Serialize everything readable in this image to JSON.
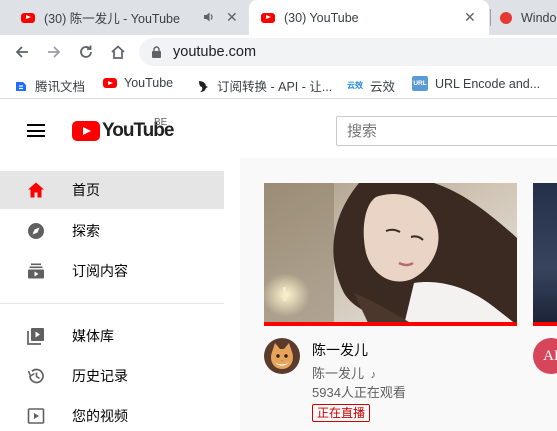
{
  "browser": {
    "tabs": [
      {
        "title": "(30) 陈一发儿 - YouTube",
        "active": false,
        "audio": true
      },
      {
        "title": "(30) YouTube",
        "active": true
      },
      {
        "title": "Windo",
        "active": false
      }
    ],
    "url": "youtube.com",
    "bookmarks": [
      {
        "label": "腾讯文档",
        "icon": "tencent-docs-icon"
      },
      {
        "label": "YouTube",
        "icon": "youtube-icon"
      },
      {
        "label": "订阅转换 - API - 让...",
        "icon": "bird-icon"
      },
      {
        "label": "云效",
        "icon": "yunxiao-icon",
        "icon_text": "云效"
      },
      {
        "label": "URL Encode and...",
        "icon": "url-icon",
        "icon_text": "URL"
      }
    ]
  },
  "masthead": {
    "logo_text": "YouTube",
    "country_code": "BE",
    "search_placeholder": "搜索"
  },
  "sidebar": {
    "items": [
      {
        "label": "首页",
        "icon": "home-icon",
        "active": true
      },
      {
        "label": "探索",
        "icon": "compass-icon",
        "active": false
      },
      {
        "label": "订阅内容",
        "icon": "subscriptions-icon",
        "active": false
      },
      {
        "label": "媒体库",
        "icon": "library-icon",
        "active": false
      },
      {
        "label": "历史记录",
        "icon": "history-icon",
        "active": false
      },
      {
        "label": "您的视频",
        "icon": "your-videos-icon",
        "active": false
      }
    ]
  },
  "feed": {
    "video": {
      "title": "陈一发儿",
      "channel": "陈一发儿",
      "channel_badge": "music-note-icon",
      "viewers": "5934人正在观看",
      "badge": "正在直播"
    },
    "next_card_avatar_text": "AI"
  },
  "colors": {
    "brand_red": "#ff0000",
    "live_red": "#cc0000",
    "sidebar_active": "#e5e5e5",
    "content_bg": "#f9f9f9",
    "tab_strip": "#dee1e6"
  }
}
